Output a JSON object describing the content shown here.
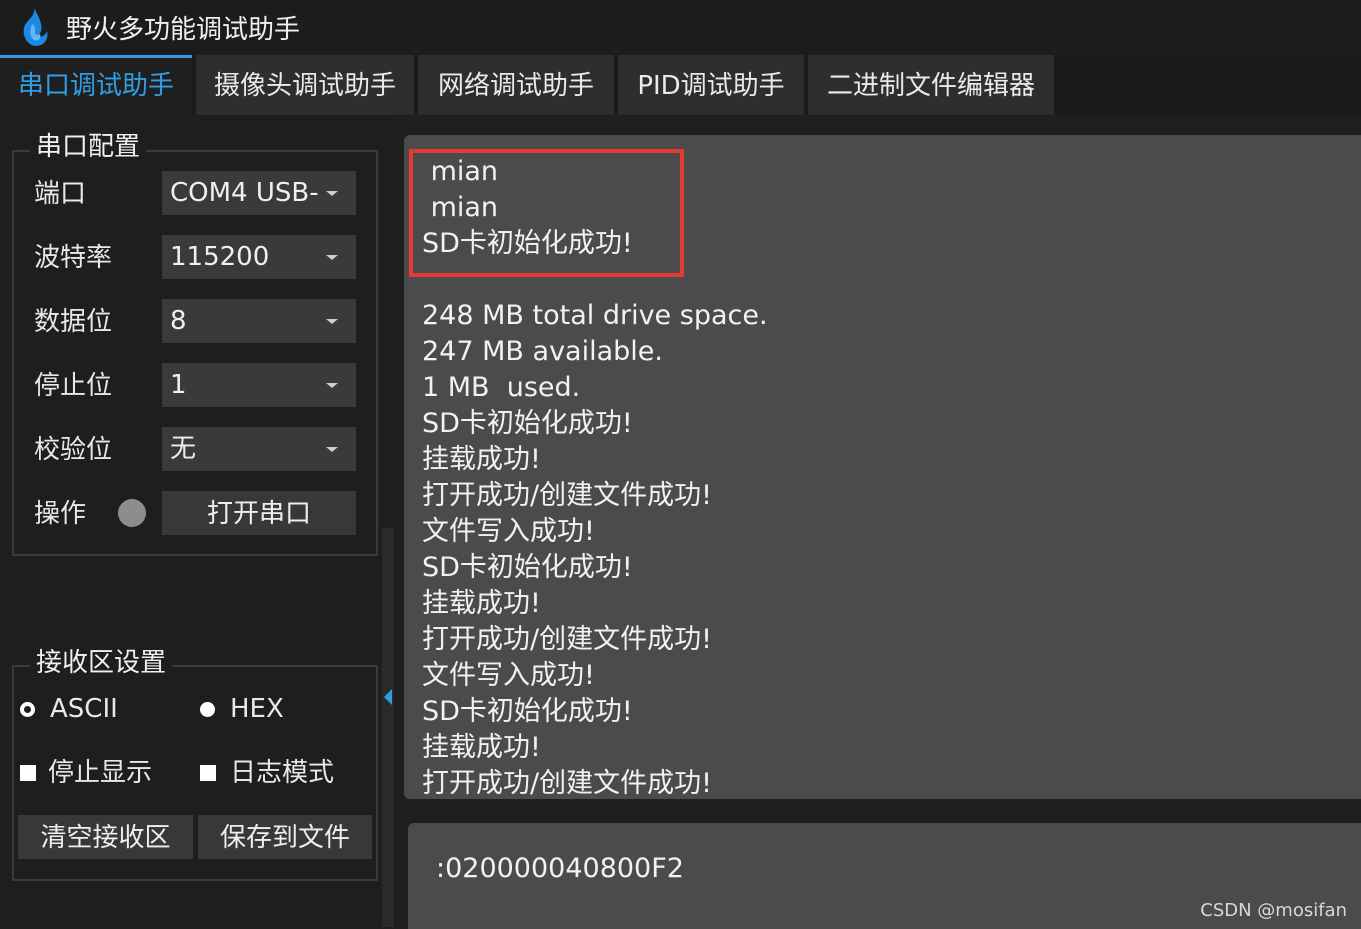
{
  "app": {
    "title": "野火多功能调试助手",
    "logo_icon": "flame-icon",
    "accent_color": "#2f9ee6"
  },
  "tabs": [
    {
      "label": "串口调试助手",
      "active": true
    },
    {
      "label": "摄像头调试助手"
    },
    {
      "label": "网络调试助手"
    },
    {
      "label": "PID调试助手"
    },
    {
      "label": "二进制文件编辑器"
    }
  ],
  "serial_config": {
    "title": "串口配置",
    "port": {
      "label": "端口",
      "value": "COM4 USB-"
    },
    "baud": {
      "label": "波特率",
      "value": "115200"
    },
    "data_bits": {
      "label": "数据位",
      "value": "8"
    },
    "stop_bits": {
      "label": "停止位",
      "value": "1"
    },
    "parity": {
      "label": "校验位",
      "value": "无"
    },
    "operation": {
      "label": "操作",
      "button": "打开串口",
      "status_color": "#8d8d8d"
    }
  },
  "receive_settings": {
    "title": "接收区设置",
    "ascii": {
      "label": "ASCII",
      "checked": true
    },
    "hex": {
      "label": "HEX",
      "checked": false
    },
    "stop_display": "停止显示",
    "log_mode": "日志模式",
    "clear_button": "清空接收区",
    "save_button": "保存到文件"
  },
  "receive_area": {
    "lines": [
      " mian",
      " mian",
      "SD卡初始化成功!",
      "",
      "248 MB total drive space.",
      "247 MB available.",
      "1 MB  used.",
      "SD卡初始化成功!",
      "挂载成功!",
      "打开成功/创建文件成功!",
      "文件写入成功!",
      "SD卡初始化成功!",
      "挂载成功!",
      "打开成功/创建文件成功!",
      "文件写入成功!",
      "SD卡初始化成功!",
      "挂载成功!",
      "打开成功/创建文件成功!"
    ],
    "highlight_color": "#e53935"
  },
  "send_area": {
    "text": ":020000040800F2"
  },
  "watermark": "CSDN @mosifan"
}
